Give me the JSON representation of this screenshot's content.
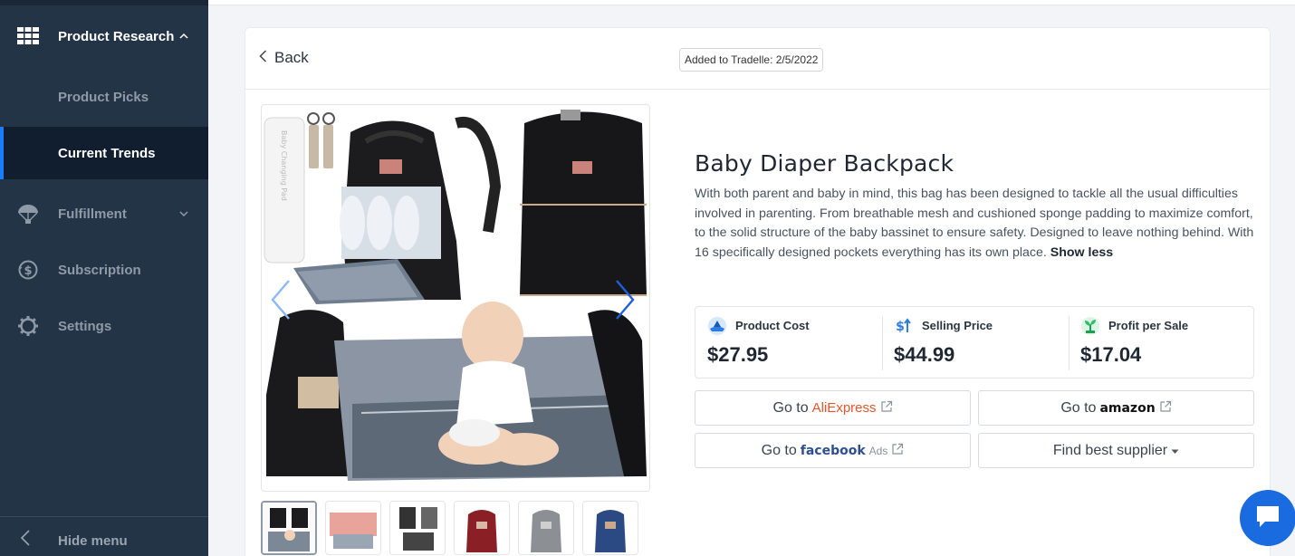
{
  "sidebar": {
    "product_research": "Product Research",
    "product_picks": "Product Picks",
    "current_trends": "Current Trends",
    "fulfillment": "Fulfillment",
    "subscription": "Subscription",
    "settings": "Settings",
    "hide_menu": "Hide menu"
  },
  "header": {
    "back_label": "Back",
    "added_label": "Added to Tradelle: 2/5/2022"
  },
  "product": {
    "title": "Baby Diaper Backpack",
    "description": "With both parent and baby in mind, this bag has been designed to tackle all the usual difficulties involved in parenting. From breathable mesh and cushioned sponge padding to maximize comfort, to the solid structure of the baby bassinet to ensure safety. Designed to leave nothing behind. With 16 specifically designed pockets everything has its own place.",
    "show_less": "Show less",
    "image_text": "Baby Changing Pad"
  },
  "stats": {
    "product_cost_label": "Product Cost",
    "product_cost_value": "$27.95",
    "selling_price_label": "Selling Price",
    "selling_price_value": "$44.99",
    "profit_label": "Profit per Sale",
    "profit_value": "$17.04"
  },
  "buttons": {
    "go_to": "Go to",
    "aliexpress": "AliExpress",
    "amazon": "amazon",
    "facebook": "facebook",
    "ads": "Ads",
    "find_supplier": "Find best supplier"
  },
  "colors": {
    "sidebar_bg": "#243447",
    "active_bg": "#101e2f",
    "accent": "#1a7cff",
    "aliexpress": "#e8542b",
    "chat": "#1a6ae0"
  }
}
